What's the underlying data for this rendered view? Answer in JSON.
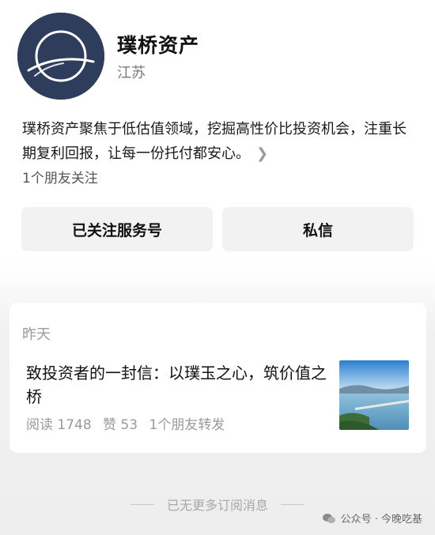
{
  "profile": {
    "name": "璞桥资产",
    "region": "江苏",
    "description": "璞桥资产聚焦于低估值领域，挖掘高性价比投资机会，注重长期复利回报，让每一份托付都安心。",
    "friends_following": "1个朋友关注"
  },
  "buttons": {
    "followed_label": "已关注服务号",
    "message_label": "私信"
  },
  "article": {
    "date": "昨天",
    "title": "致投资者的一封信：以璞玉之心，筑价值之桥",
    "reads": "阅读 1748",
    "likes": "赞 53",
    "shares": "1个朋友转发"
  },
  "footer": {
    "no_more": "已无更多订阅消息"
  },
  "watermark": {
    "text": "公众号 · 今晚吃基"
  },
  "colors": {
    "avatar_bg": "#2f3d5d",
    "button_bg": "#f2f2f2"
  }
}
